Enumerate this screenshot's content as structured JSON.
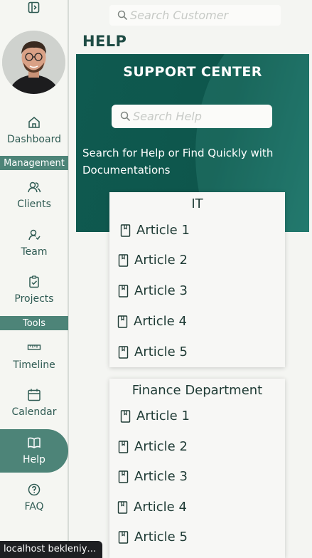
{
  "sidebar": {
    "toggle_icon": "sidebar-toggle-icon",
    "items": [
      {
        "label": "Dashboard",
        "icon": "home-icon"
      },
      {
        "label": "Clients",
        "icon": "users-icon"
      },
      {
        "label": "Team",
        "icon": "team-icon"
      },
      {
        "label": "Projects",
        "icon": "clipboard-check-icon"
      },
      {
        "label": "Timeline",
        "icon": "ruler-icon"
      },
      {
        "label": "Calendar",
        "icon": "calendar-icon"
      },
      {
        "label": "Help",
        "icon": "book-icon"
      },
      {
        "label": "FAQ",
        "icon": "question-icon"
      }
    ],
    "sections": {
      "management": "Management",
      "tools": "Tools"
    },
    "active": "Help"
  },
  "topbar": {
    "search_placeholder": "Search Customer"
  },
  "page": {
    "title": "HELP"
  },
  "hero": {
    "title": "SUPPORT CENTER",
    "search_placeholder": "Search Help",
    "text": "Search for Help or Find Quickly with Documentations"
  },
  "cards": [
    {
      "title": "IT",
      "articles": [
        "Article 1",
        "Article 2",
        "Article 3",
        "Article 4",
        "Article 5"
      ]
    },
    {
      "title": "Finance Department",
      "articles": [
        "Article 1",
        "Article 2",
        "Article 3",
        "Article 4",
        "Article 5"
      ]
    }
  ],
  "status_bar": {
    "text": "localhost bekleniyor..."
  },
  "colors": {
    "accent": "#4d8478",
    "hero": "#0f5a50",
    "title": "#1f4c45"
  }
}
